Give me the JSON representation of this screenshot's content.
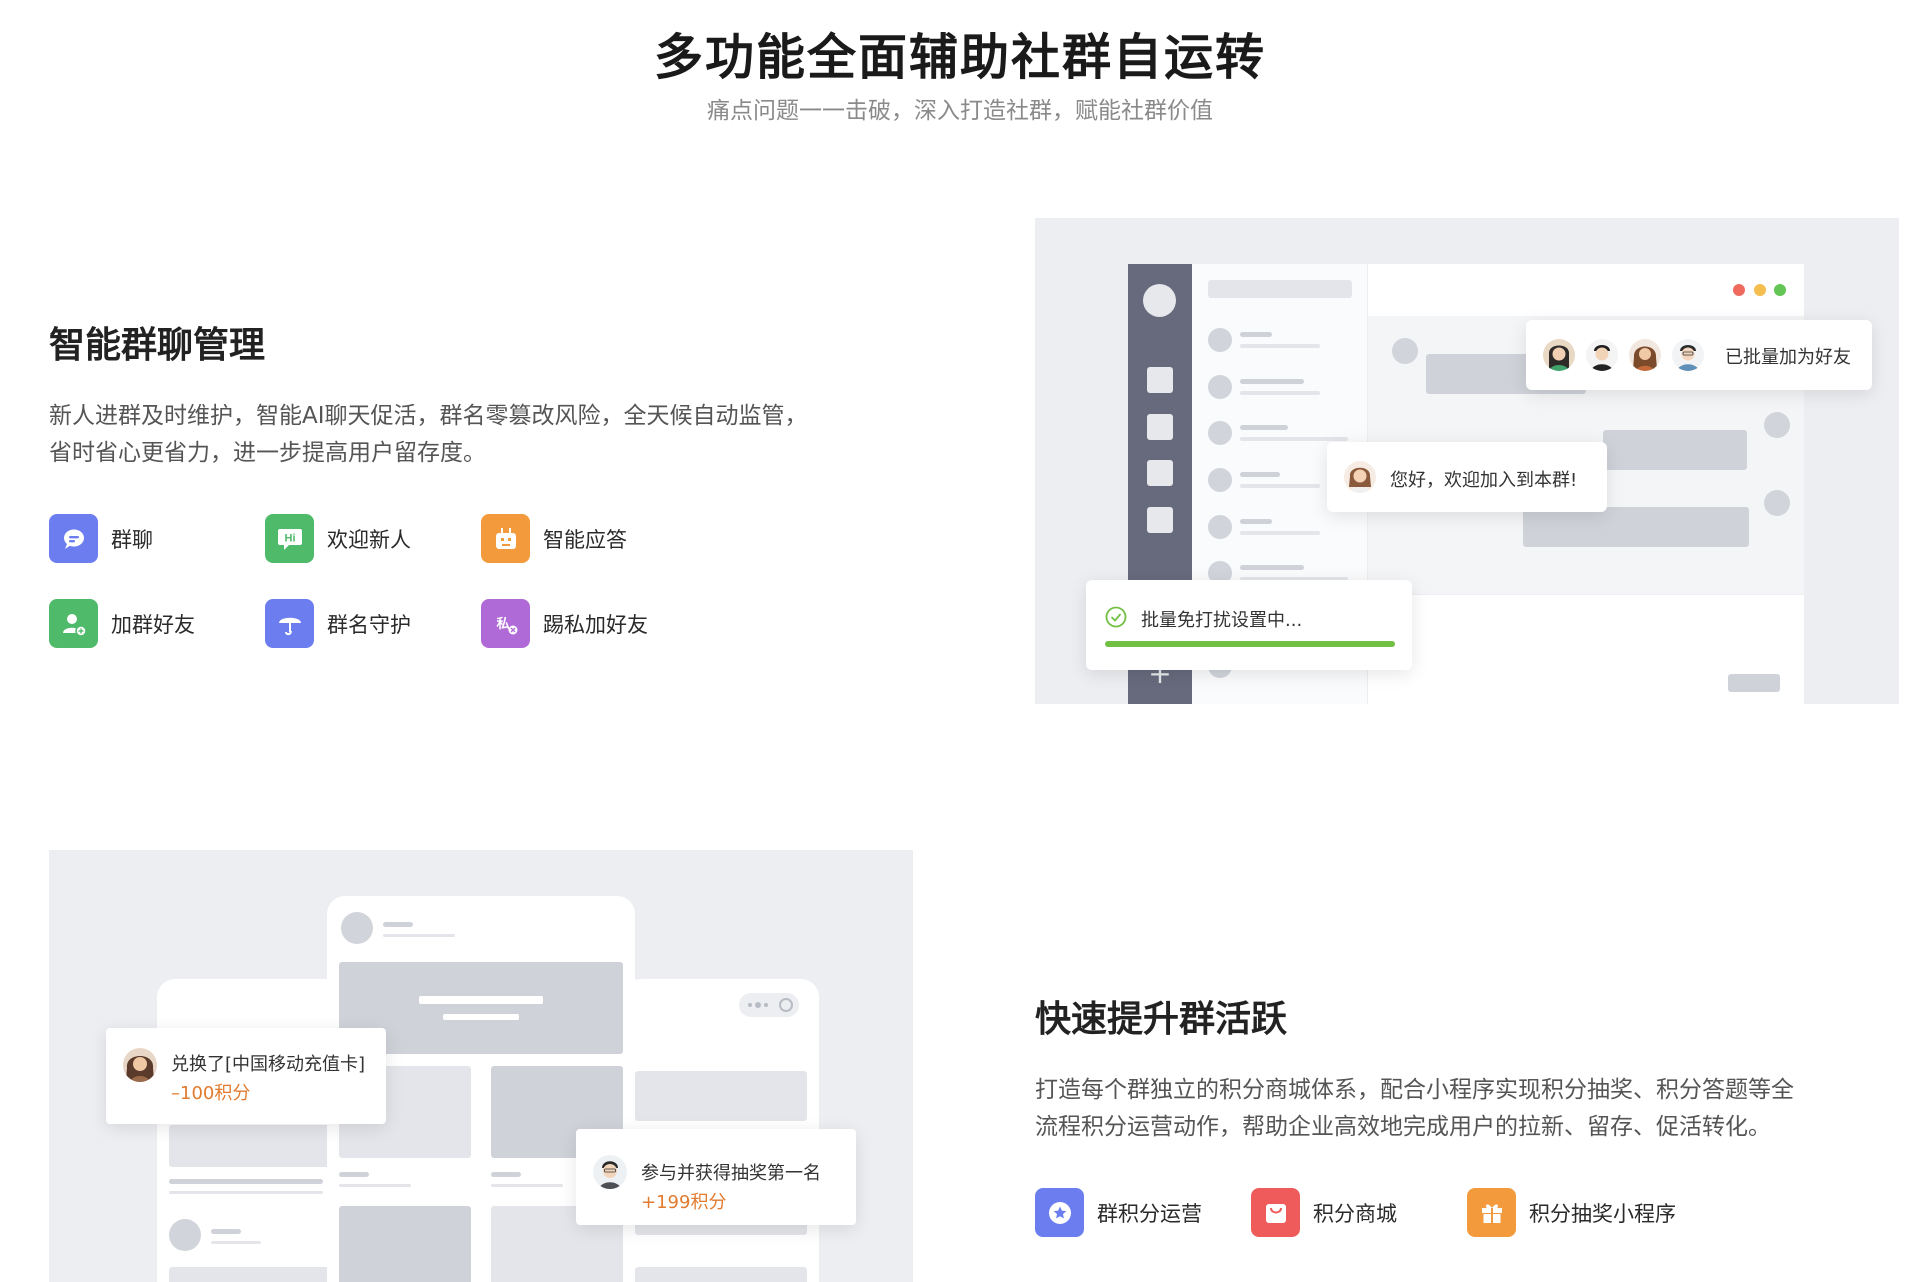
{
  "header": {
    "title": "多功能全面辅助社群自运转",
    "subtitle": "痛点问题一一击破，深入打造社群，赋能社群价值"
  },
  "section1": {
    "title": "智能群聊管理",
    "desc_line1": "新人进群及时维护，智能AI聊天促活，群名零篡改风险，全天候自动监管，",
    "desc_line2": "省时省心更省力，进一步提高用户留存度。",
    "features": [
      {
        "label": "群聊",
        "icon": "chat-icon",
        "color": "#6c7df0"
      },
      {
        "label": "欢迎新人",
        "icon": "hi-icon",
        "color": "#4fbb6a"
      },
      {
        "label": "智能应答",
        "icon": "robot-icon",
        "color": "#f39a3c"
      },
      {
        "label": "加群好友",
        "icon": "add-user-icon",
        "color": "#4fbb6a"
      },
      {
        "label": "群名守护",
        "icon": "umbrella-icon",
        "color": "#6c7df0"
      },
      {
        "label": "踢私加好友",
        "icon": "private-icon",
        "color": "#b06ad8"
      }
    ],
    "mock": {
      "batch_friend_text": "已批量加为好友",
      "welcome_text": "您好，欢迎加入到本群!",
      "dnd_text": "批量免打扰设置中...",
      "dnd_progress": 1.0,
      "window_dot_colors": [
        "#ee6a5e",
        "#f4be4f",
        "#62c554"
      ],
      "progress_color": "#72c043"
    }
  },
  "section2": {
    "title": "快速提升群活跃",
    "desc_line1": "打造每个群独立的积分商城体系，配合小程序实现积分抽奖、积分答题等全",
    "desc_line2": "流程积分运营动作，帮助企业高效地完成用户的拉新、留存、促活转化。",
    "features": [
      {
        "label": "群积分运营",
        "icon": "star-badge-icon",
        "color": "#6c7df0"
      },
      {
        "label": "积分商城",
        "icon": "shopping-bag-icon",
        "color": "#ef5b5b"
      },
      {
        "label": "积分抽奖小程序",
        "icon": "gift-icon",
        "color": "#f39a3c"
      }
    ],
    "mock": {
      "redeem_text": "兑换了[中国移动充值卡]",
      "redeem_points": "–100积分",
      "lottery_text": "参与并获得抽奖第一名",
      "lottery_points": "+199积分"
    }
  }
}
